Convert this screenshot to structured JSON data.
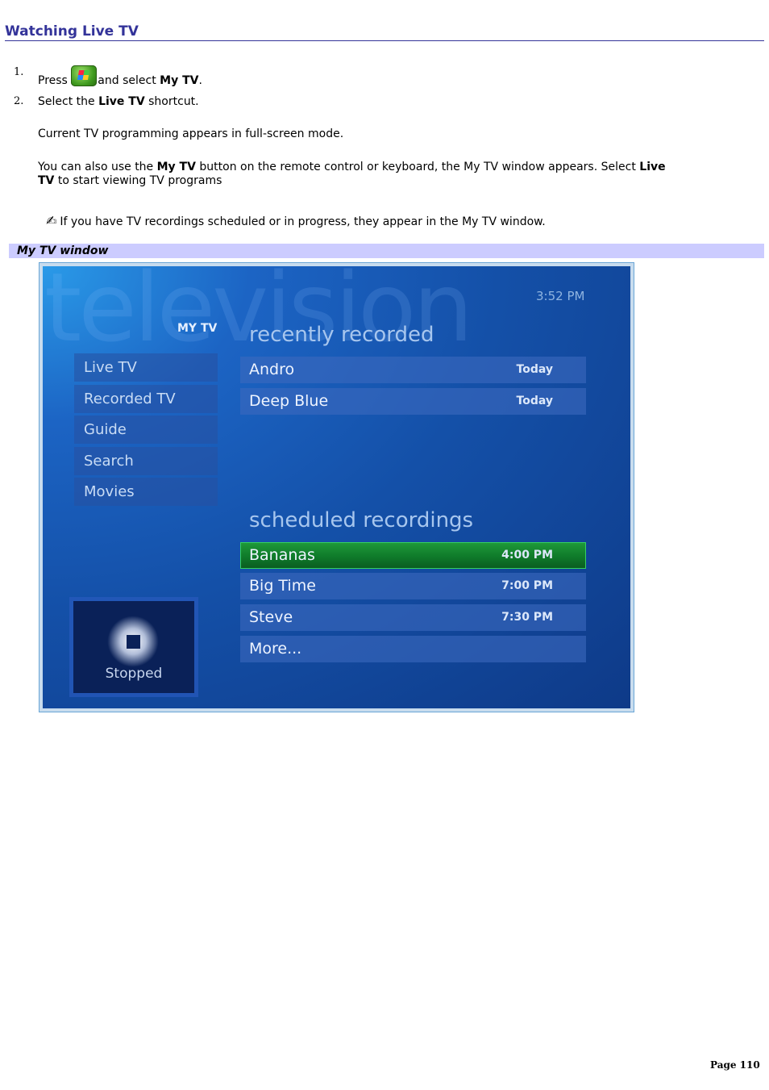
{
  "heading": "Watching Live TV",
  "steps": [
    {
      "num": "1.",
      "pre": "Press ",
      "icon": "windows-start-button-icon",
      "mid": "and select ",
      "bold": "My TV",
      "post": "."
    },
    {
      "num": "2.",
      "pre": "Select the ",
      "bold": "Live TV",
      "post": " shortcut."
    }
  ],
  "para1": "Current TV programming appears in full-screen mode.",
  "para2": {
    "a": "You can also use the ",
    "b": "My TV",
    "c": " button on the remote control or keyboard, the My TV window appears. Select ",
    "d": "Live",
    "e": "TV",
    "f": " to start viewing TV programs"
  },
  "note": {
    "icon": "note-pen-icon",
    "glyph": "✍",
    "text": "If you have TV recordings scheduled or in progress, they appear in the My TV window."
  },
  "caption": "My TV window",
  "tv": {
    "background_word": "television",
    "clock": "3:52 PM",
    "section_label": "MY TV",
    "menu": [
      "Live TV",
      "Recorded TV",
      "Guide",
      "Search",
      "Movies"
    ],
    "recently_recorded": {
      "title": "recently recorded",
      "items": [
        {
          "name": "Andro",
          "when": "Today"
        },
        {
          "name": "Deep Blue",
          "when": "Today"
        }
      ]
    },
    "scheduled": {
      "title": "scheduled recordings",
      "items": [
        {
          "name": "Bananas",
          "when": "4:00 PM",
          "selected": true
        },
        {
          "name": "Big Time",
          "when": "7:00 PM"
        },
        {
          "name": "Steve",
          "when": "7:30 PM"
        },
        {
          "name": "More...",
          "when": ""
        }
      ]
    },
    "player_status": "Stopped",
    "colors": {
      "selected": "#1a8a34",
      "accent_text": "#a7c6ee"
    }
  },
  "page_label": "Page 110"
}
